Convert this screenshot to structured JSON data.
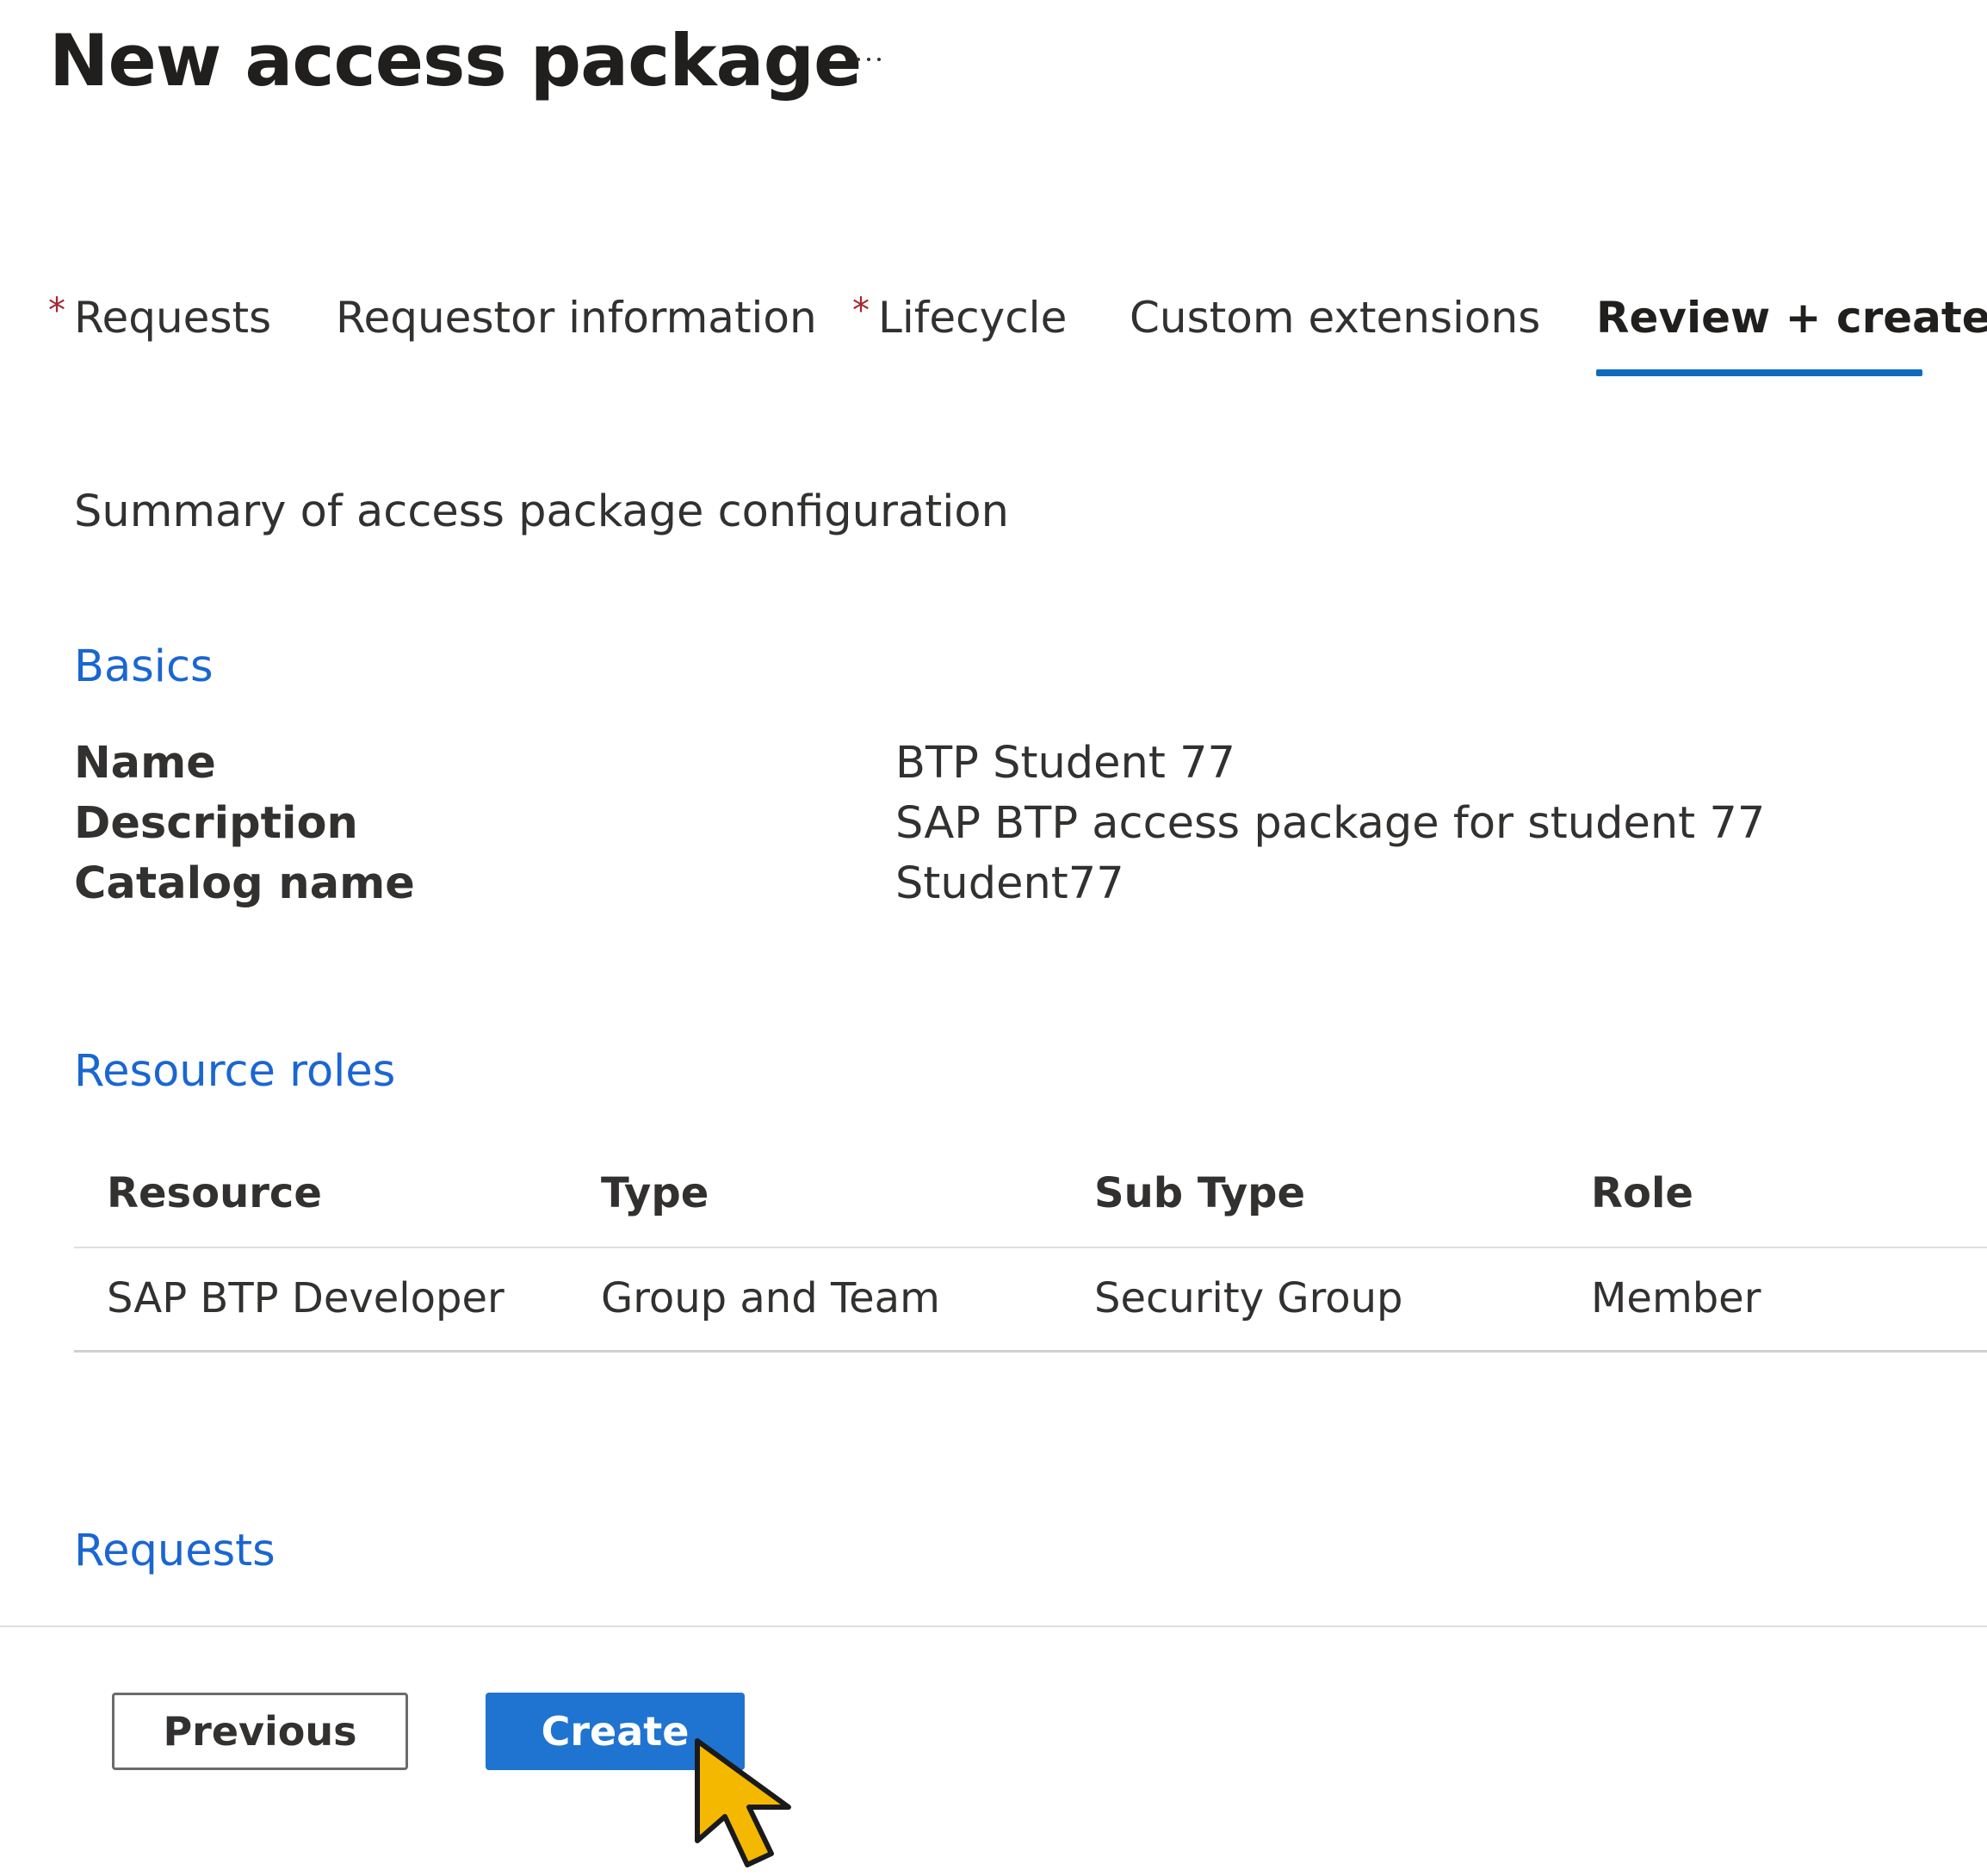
{
  "header": {
    "title": "New access package",
    "more_icon": "more-horizontal-icon"
  },
  "tabs": [
    {
      "label": "Requests",
      "required": true,
      "required_mark": "*",
      "active": false
    },
    {
      "label": "Requestor information",
      "required": false,
      "active": false
    },
    {
      "label": "Lifecycle",
      "required": true,
      "required_mark": "*",
      "active": false
    },
    {
      "label": "Custom extensions",
      "required": false,
      "active": false
    },
    {
      "label": "Review + create",
      "required": false,
      "active": true
    }
  ],
  "summary": "Summary of access package configuration",
  "basics": {
    "heading": "Basics",
    "fields": [
      {
        "label": "Name",
        "value": "BTP Student 77"
      },
      {
        "label": "Description",
        "value": "SAP BTP access package for student 77"
      },
      {
        "label": "Catalog name",
        "value": "Student77"
      }
    ]
  },
  "resource_roles": {
    "heading": "Resource roles",
    "columns": [
      "Resource",
      "Type",
      "Sub Type",
      "Role"
    ],
    "rows": [
      [
        "SAP BTP Developer",
        "Group and Team",
        "Security Group",
        "Member"
      ]
    ]
  },
  "requests": {
    "heading": "Requests"
  },
  "footer": {
    "previous_label": "Previous",
    "create_label": "Create"
  },
  "colors": {
    "accent": "#0f6cbd",
    "link": "#1a66d2",
    "primary_button": "#1f73d1",
    "required_mark": "#a4262c",
    "cursor_fill": "#f5b800"
  },
  "cursor_icon": "mouse-pointer-icon"
}
